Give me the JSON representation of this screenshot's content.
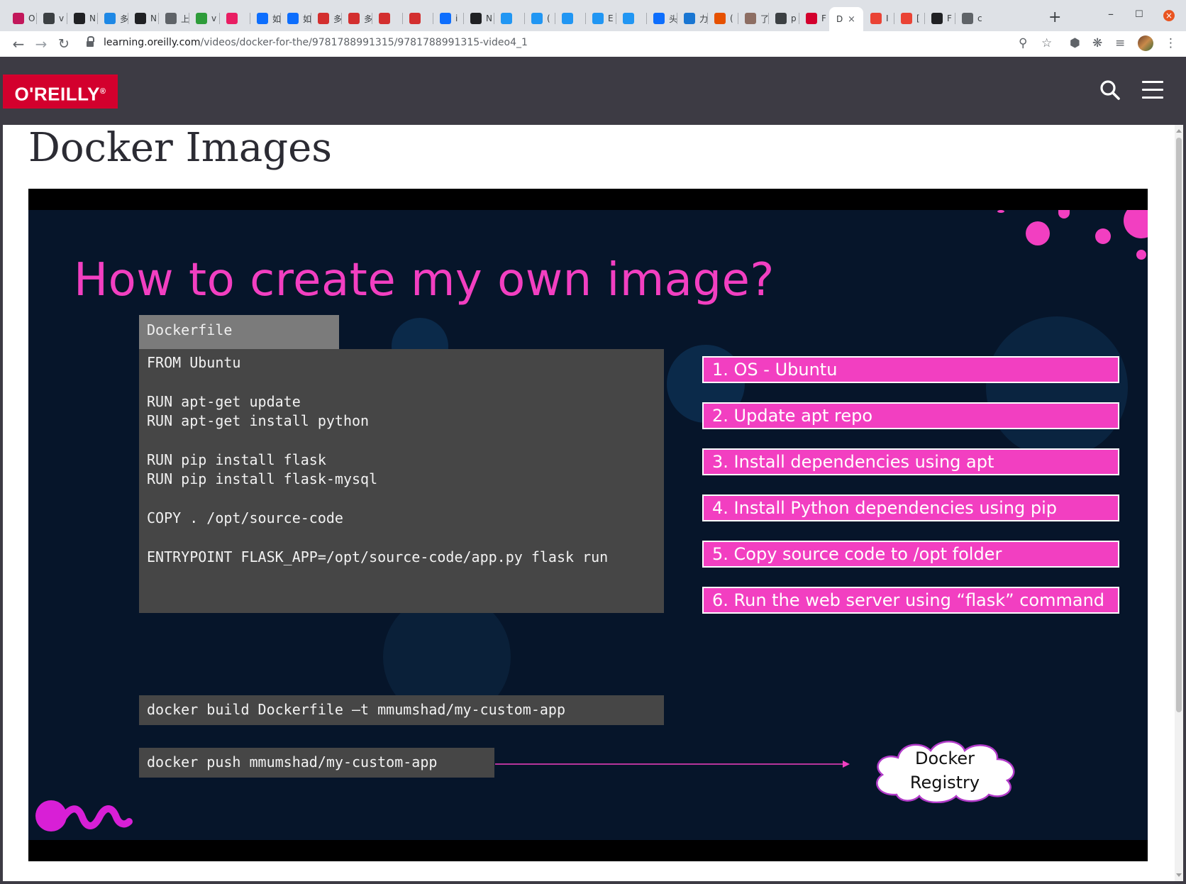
{
  "browser": {
    "tabs": [
      {
        "title": "O",
        "color": "#c2185b"
      },
      {
        "title": "v",
        "color": "#3c4043"
      },
      {
        "title": "N",
        "color": "#202124"
      },
      {
        "title": "多",
        "color": "#1e88e5"
      },
      {
        "title": "N",
        "color": "#202124"
      },
      {
        "title": "上",
        "color": "#5f6368"
      },
      {
        "title": "v",
        "color": "#2e9c3a"
      },
      {
        "title": "",
        "color": "#e91e63"
      },
      {
        "title": "如",
        "color": "#0d6efd"
      },
      {
        "title": "如",
        "color": "#0d6efd"
      },
      {
        "title": "多",
        "color": "#d32f2f"
      },
      {
        "title": "多",
        "color": "#d32f2f"
      },
      {
        "title": "",
        "color": "#d32f2f"
      },
      {
        "title": "",
        "color": "#d32f2f"
      },
      {
        "title": "i",
        "color": "#0d6efd"
      },
      {
        "title": "N",
        "color": "#202124"
      },
      {
        "title": "",
        "color": "#2196f3"
      },
      {
        "title": "(",
        "color": "#2196f3"
      },
      {
        "title": "",
        "color": "#2196f3"
      },
      {
        "title": "E",
        "color": "#2196f3"
      },
      {
        "title": "",
        "color": "#2196f3"
      },
      {
        "title": "头",
        "color": "#0d6efd"
      },
      {
        "title": "力",
        "color": "#1976d2"
      },
      {
        "title": "(",
        "color": "#e65100"
      },
      {
        "title": "了",
        "color": "#8d6e63"
      },
      {
        "title": "p",
        "color": "#3c4043"
      },
      {
        "title": "F",
        "color": "#d3002d"
      }
    ],
    "active_tab": {
      "title": "D",
      "close": "×"
    },
    "tabs_after": [
      {
        "title": "I",
        "color": "#ea4335"
      },
      {
        "title": "[",
        "color": "#ea4335"
      },
      {
        "title": "F",
        "color": "#202124"
      },
      {
        "title": "c",
        "color": "#5f6368"
      }
    ],
    "new_tab": "+",
    "window_controls": {
      "minimize": "–",
      "maximize": "☐",
      "close": "×"
    },
    "url": {
      "domain": "learning.oreilly.com",
      "path": "/videos/docker-for-the/9781788991315/9781788991315-video4_1"
    }
  },
  "site": {
    "logo": "O'REILLY",
    "logo_mark": "®",
    "page_title": "Docker Images"
  },
  "slide": {
    "title": "How to create my own image?",
    "dockerfile_label": "Dockerfile",
    "code_lines": [
      "FROM Ubuntu",
      "",
      "RUN apt-get update",
      "RUN apt-get install python",
      "",
      "RUN pip install flask",
      "RUN pip install flask-mysql",
      "",
      "COPY . /opt/source-code",
      "",
      "ENTRYPOINT FLASK_APP=/opt/source-code/app.py flask run"
    ],
    "steps": [
      "1. OS - Ubuntu",
      "2. Update apt repo",
      "3. Install dependencies using apt",
      "4. Install Python dependencies using pip",
      "5. Copy source code to /opt folder",
      "6. Run the web server using “flask” command"
    ],
    "build_command": "docker build Dockerfile –t mmumshad/my-custom-app",
    "push_command": "docker push mmumshad/my-custom-app",
    "registry_line1": "Docker",
    "registry_line2": "Registry",
    "colors": {
      "accent": "#f23fc1",
      "background": "#06152a",
      "code_bg": "#464646"
    }
  }
}
